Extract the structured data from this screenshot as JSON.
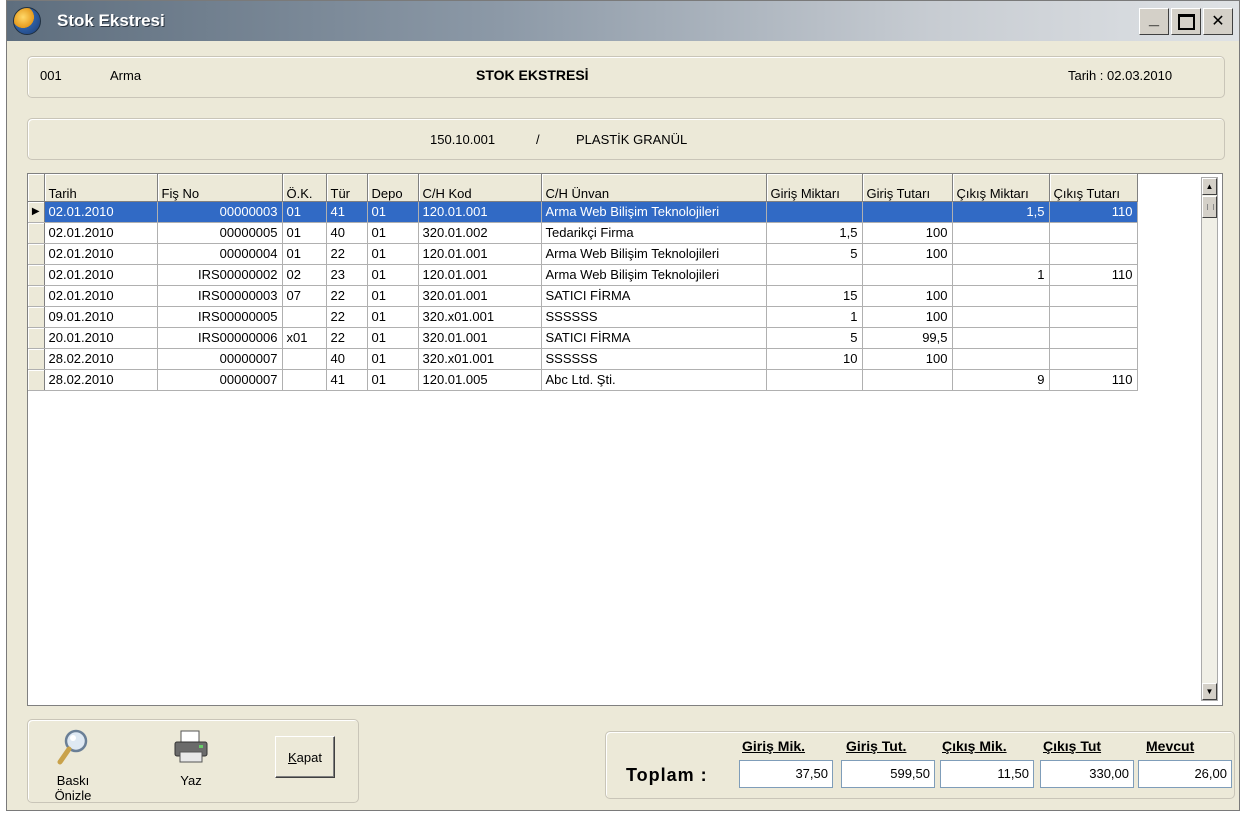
{
  "window": {
    "title": "Stok Ekstresi",
    "minimize": "_",
    "close": "✕"
  },
  "header": {
    "company_code": "001",
    "company_name": "Arma",
    "report_title": "STOK EKSTRESİ",
    "date_text": "Tarih : 02.03.2010"
  },
  "item": {
    "code": "150.10.001",
    "separator": "/",
    "name": "PLASTİK GRANÜL"
  },
  "grid": {
    "columns": [
      "Tarih",
      "Fiş No",
      "Ö.K.",
      "Tür",
      "Depo",
      "C/H Kod",
      "C/H Ünvan",
      "Giriş Miktarı",
      "Giriş Tutarı",
      "Çıkış Miktarı",
      "Çıkış Tutarı"
    ],
    "rows": [
      [
        "02.01.2010",
        "00000003",
        "01",
        "41",
        "01",
        "120.01.001",
        "Arma Web Bilişim Teknolojileri",
        "",
        "",
        "1,5",
        "110"
      ],
      [
        "02.01.2010",
        "00000005",
        "01",
        "40",
        "01",
        "320.01.002",
        "Tedarikçi Firma",
        "1,5",
        "100",
        "",
        ""
      ],
      [
        "02.01.2010",
        "00000004",
        "01",
        "22",
        "01",
        "120.01.001",
        "Arma Web Bilişim Teknolojileri",
        "5",
        "100",
        "",
        ""
      ],
      [
        "02.01.2010",
        "IRS00000002",
        "02",
        "23",
        "01",
        "120.01.001",
        "Arma Web Bilişim Teknolojileri",
        "",
        "",
        "1",
        "110"
      ],
      [
        "02.01.2010",
        "IRS00000003",
        "07",
        "22",
        "01",
        "320.01.001",
        "SATICI FİRMA",
        "15",
        "100",
        "",
        ""
      ],
      [
        "09.01.2010",
        "IRS00000005",
        "",
        "22",
        "01",
        "320.x01.001",
        "SSSSSS",
        "1",
        "100",
        "",
        ""
      ],
      [
        "20.01.2010",
        "IRS00000006",
        "x01",
        "22",
        "01",
        "320.01.001",
        "SATICI FİRMA",
        "5",
        "99,5",
        "",
        ""
      ],
      [
        "28.02.2010",
        "00000007",
        "",
        "40",
        "01",
        "320.x01.001",
        "SSSSSS",
        "10",
        "100",
        "",
        ""
      ],
      [
        "28.02.2010",
        "00000007",
        "",
        "41",
        "01",
        "120.01.005",
        "Abc Ltd. Şti.",
        "",
        "",
        "9",
        "110"
      ]
    ],
    "selected_row": 0
  },
  "toolbar": {
    "preview_label": "Baskı Önizle",
    "print_label": "Yaz",
    "close_prefix": "",
    "close_underlined": "K",
    "close_rest": "apat"
  },
  "totals": {
    "label": "Toplam :",
    "headers": [
      "Giriş Mik.",
      "Giriş Tut.",
      "Çıkış Mik.",
      "Çıkış Tut",
      "Mevcut"
    ],
    "values": [
      "37,50",
      "599,50",
      "11,50",
      "330,00",
      "26,00"
    ]
  },
  "colors": {
    "selection": "#316ac5",
    "window_bg": "#ece9d8"
  }
}
